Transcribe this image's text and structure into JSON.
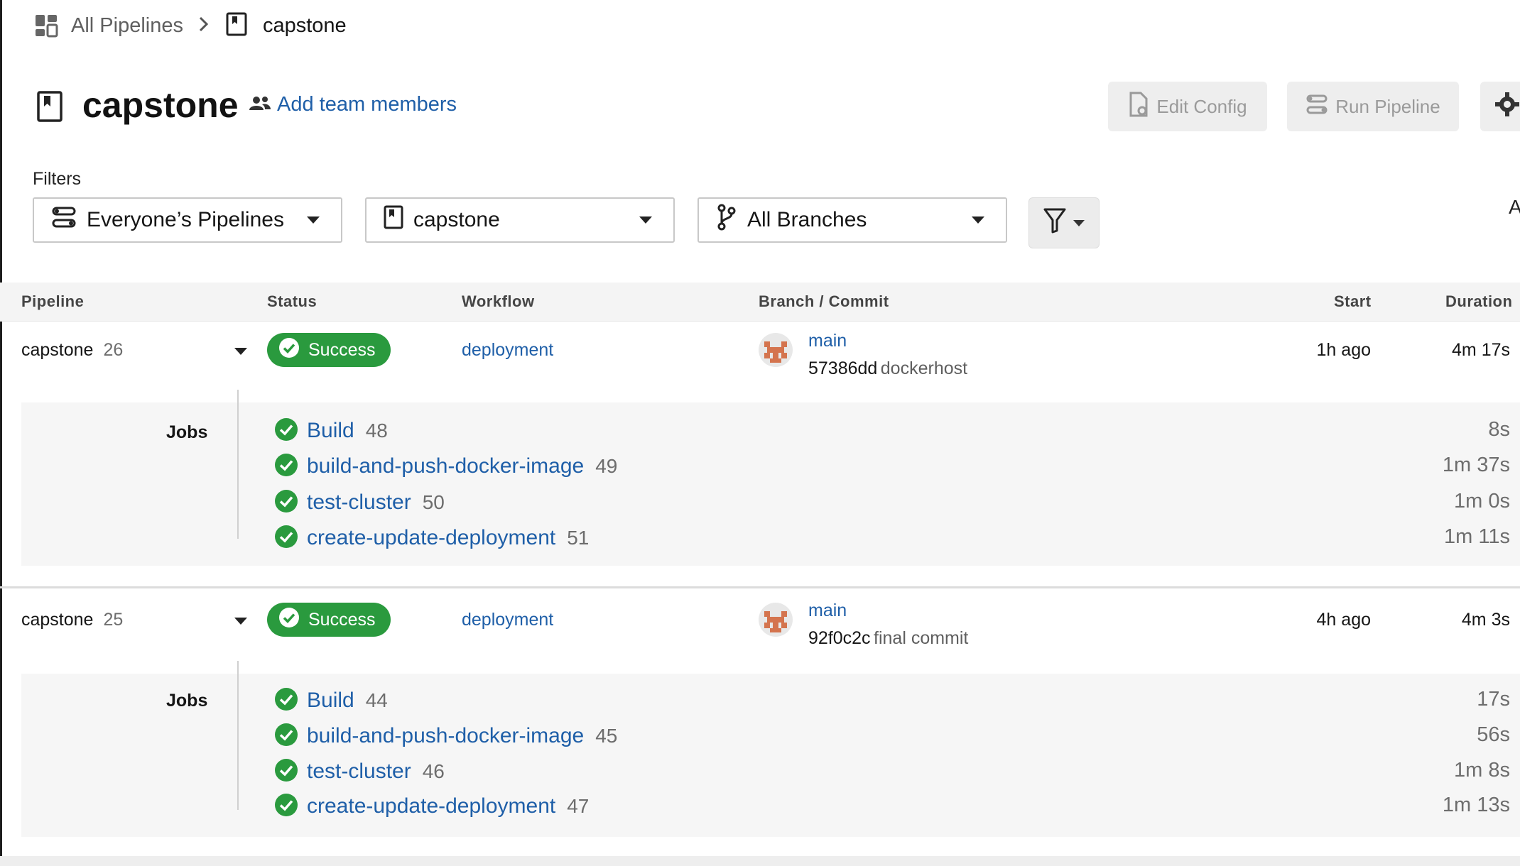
{
  "breadcrumb": {
    "all_pipelines": "All Pipelines",
    "separator": ">",
    "current": "capstone"
  },
  "header": {
    "title": "capstone",
    "add_team": "Add team members",
    "edit_config": "Edit Config",
    "run_pipeline": "Run Pipeline"
  },
  "filters": {
    "label": "Filters",
    "owner": "Everyone’s Pipelines",
    "project": "capstone",
    "branch": "All Branches",
    "overflow_text": "A"
  },
  "table": {
    "columns": {
      "pipeline": "Pipeline",
      "status": "Status",
      "workflow": "Workflow",
      "branch_commit": "Branch / Commit",
      "start": "Start",
      "duration": "Duration"
    }
  },
  "pipelines": [
    {
      "name": "capstone",
      "number": "26",
      "status": "Success",
      "workflow": "deployment",
      "branch": "main",
      "commit_hash": "57386dd",
      "commit_msg": "dockerhost",
      "start": "1h ago",
      "duration": "4m 17s",
      "jobs_label": "Jobs",
      "jobs": [
        {
          "name": "Build",
          "number": "48",
          "duration": "8s"
        },
        {
          "name": "build-and-push-docker-image",
          "number": "49",
          "duration": "1m 37s"
        },
        {
          "name": "test-cluster",
          "number": "50",
          "duration": "1m 0s"
        },
        {
          "name": "create-update-deployment",
          "number": "51",
          "duration": "1m 11s"
        }
      ]
    },
    {
      "name": "capstone",
      "number": "25",
      "status": "Success",
      "workflow": "deployment",
      "branch": "main",
      "commit_hash": "92f0c2c",
      "commit_msg": "final commit",
      "start": "4h ago",
      "duration": "4m 3s",
      "jobs_label": "Jobs",
      "jobs": [
        {
          "name": "Build",
          "number": "44",
          "duration": "17s"
        },
        {
          "name": "build-and-push-docker-image",
          "number": "45",
          "duration": "56s"
        },
        {
          "name": "test-cluster",
          "number": "46",
          "duration": "1m 8s"
        },
        {
          "name": "create-update-deployment",
          "number": "47",
          "duration": "1m 13s"
        }
      ]
    }
  ],
  "colors": {
    "success": "#2a9a3e",
    "link": "#1f5fa8",
    "avatar": "#d4744e"
  }
}
